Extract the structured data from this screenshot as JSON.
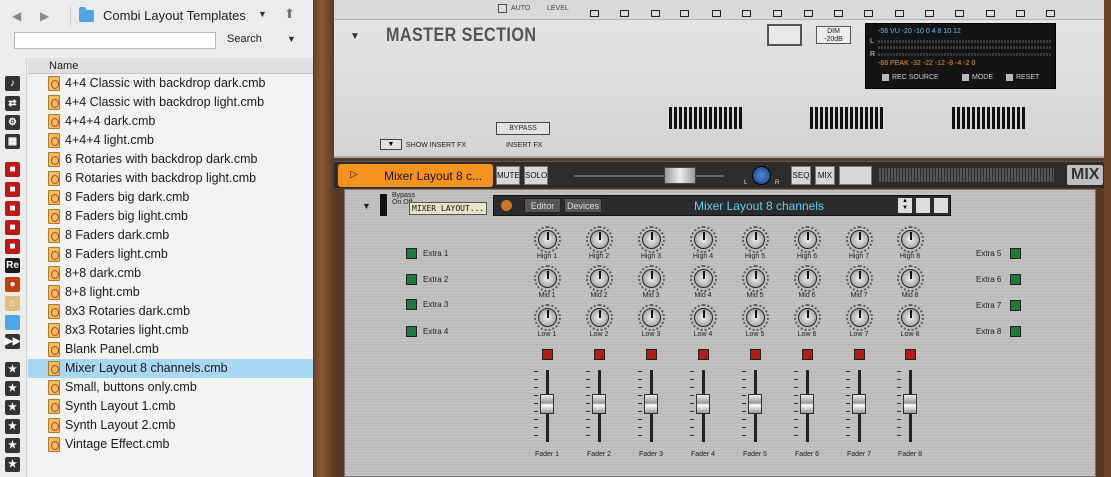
{
  "browser": {
    "crumb": "Combi Layout Templates",
    "search_label": "Search",
    "search_value": "",
    "column_header": "Name",
    "files": [
      "4+4 Classic with backdrop dark.cmb",
      "4+4 Classic with backdrop light.cmb",
      "4+4+4 dark.cmb",
      "4+4+4 light.cmb",
      "6 Rotaries with backdrop dark.cmb",
      "6 Rotaries with backdrop light.cmb",
      "8 Faders big dark.cmb",
      "8 Faders big light.cmb",
      "8 Faders dark.cmb",
      "8 Faders light.cmb",
      "8+8 dark.cmb",
      "8+8 light.cmb",
      "8x3 Rotaries dark.cmb",
      "8x3 Rotaries light.cmb",
      "Blank Panel.cmb",
      "Mixer Layout 8 channels.cmb",
      "Small, buttons only.cmb",
      "Synth Layout 1.cmb",
      "Synth Layout 2.cmb",
      "Vintage Effect.cmb"
    ],
    "selected_index": 15
  },
  "master": {
    "auto_label": "AUTO",
    "level_label": "LEVEL",
    "title": "MASTER SECTION",
    "dim_label": "DIM -20dB",
    "meter_scale_vu": "-56  VU  -20   -10    0    4   8  10 12",
    "meter_scale_peak": "-68  PEAK  -32   -22   -12   -8   -4  -2  0",
    "meter_l": "L",
    "meter_r": "R",
    "rec_source": "REC SOURCE",
    "mode": "MODE",
    "reset": "RESET",
    "show_insert_fx": "SHOW INSERT FX",
    "bypass": "BYPASS",
    "insert_fx": "INSERT FX"
  },
  "mixbar": {
    "name": "Mixer Layout 8 c...",
    "mute": "MUTE",
    "solo": "SOLO",
    "pan_l": "L",
    "pan_r": "R",
    "seq": "SEQ",
    "mix": "MIX",
    "mix_title": "MIX"
  },
  "device": {
    "bypass_on_off": "Bypass On Off",
    "name_tape": "MIXER LAYOUT...",
    "tab_editor": "Editor",
    "tab_devices": "Devices",
    "panel_title": "Mixer Layout 8 channels",
    "extras_left": [
      "Extra 1",
      "Extra 2",
      "Extra 3",
      "Extra 4"
    ],
    "extras_right": [
      "Extra 5",
      "Extra 6",
      "Extra 7",
      "Extra 8"
    ],
    "channels": [
      {
        "high": "High 1",
        "mid": "Mid 1",
        "low": "Low 1",
        "fader": "Fader 1"
      },
      {
        "high": "High 2",
        "mid": "Mid 2",
        "low": "Low 2",
        "fader": "Fader 2"
      },
      {
        "high": "High 3",
        "mid": "Mid 3",
        "low": "Low 3",
        "fader": "Fader 3"
      },
      {
        "high": "High 4",
        "mid": "Mid 4",
        "low": "Low 4",
        "fader": "Fader 4"
      },
      {
        "high": "High 5",
        "mid": "Mid 5",
        "low": "Low 5",
        "fader": "Fader 5"
      },
      {
        "high": "High 6",
        "mid": "Mid 6",
        "low": "Low 6",
        "fader": "Fader 6"
      },
      {
        "high": "High 7",
        "mid": "Mid 7",
        "low": "Low 7",
        "fader": "Fader 7"
      },
      {
        "high": "High 8",
        "mid": "Mid 8",
        "low": "Low 8",
        "fader": "Fader 8"
      }
    ]
  },
  "colors": {
    "accent_orange": "#f59320",
    "selection_blue": "#a9d8f6",
    "panel_title_cyan": "#5ed0ee"
  }
}
